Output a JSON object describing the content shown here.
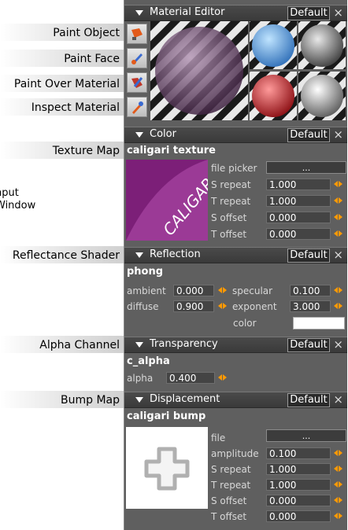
{
  "callouts": {
    "paint_object": "Paint Object",
    "paint_face": "Paint Face",
    "paint_over_material": "Paint Over Material",
    "inspect_material": "Inspect Material",
    "texture_map": "Texture Map",
    "input_window_line1": "nput",
    "input_window_line2": "Window",
    "reflectance_shader": "Reflectance Shader",
    "alpha_channel": "Alpha Channel",
    "bump_map": "Bump Map"
  },
  "material_editor": {
    "title": "Material Editor",
    "default": "Default",
    "close": "×"
  },
  "color": {
    "title": "Color",
    "default": "Default",
    "close": "×",
    "shader": "caligari texture",
    "logo_text": "CALIGARI",
    "file_picker_label": "file picker",
    "file_picker_value": "...",
    "s_repeat_label": "S repeat",
    "s_repeat": "1.000",
    "t_repeat_label": "T repeat",
    "t_repeat": "1.000",
    "s_offset_label": "S offset",
    "s_offset": "0.000",
    "t_offset_label": "T offset",
    "t_offset": "0.000"
  },
  "reflection": {
    "title": "Reflection",
    "default": "Default",
    "close": "×",
    "shader": "phong",
    "ambient_label": "ambient",
    "ambient": "0.000",
    "specular_label": "specular",
    "specular": "0.100",
    "diffuse_label": "diffuse",
    "diffuse": "0.900",
    "exponent_label": "exponent",
    "exponent": "3.000",
    "color_label": "color",
    "color_value": "#ffffff"
  },
  "transparency": {
    "title": "Transparency",
    "default": "Default",
    "close": "×",
    "shader": "c_alpha",
    "alpha_label": "alpha",
    "alpha": "0.400"
  },
  "displacement": {
    "title": "Displacement",
    "default": "Default",
    "close": "×",
    "shader": "caligari bump",
    "file_label": "file",
    "file_value": "...",
    "amplitude_label": "amplitude",
    "amplitude": "0.100",
    "s_repeat_label": "S repeat",
    "s_repeat": "1.000",
    "t_repeat_label": "T repeat",
    "t_repeat": "1.000",
    "s_offset_label": "S offset",
    "s_offset": "0.000",
    "t_offset_label": "T offset",
    "t_offset": "0.000"
  },
  "colors": {
    "accent": "#ff9a00",
    "panel": "#5f5f5f",
    "header": "#3a3a3a"
  }
}
